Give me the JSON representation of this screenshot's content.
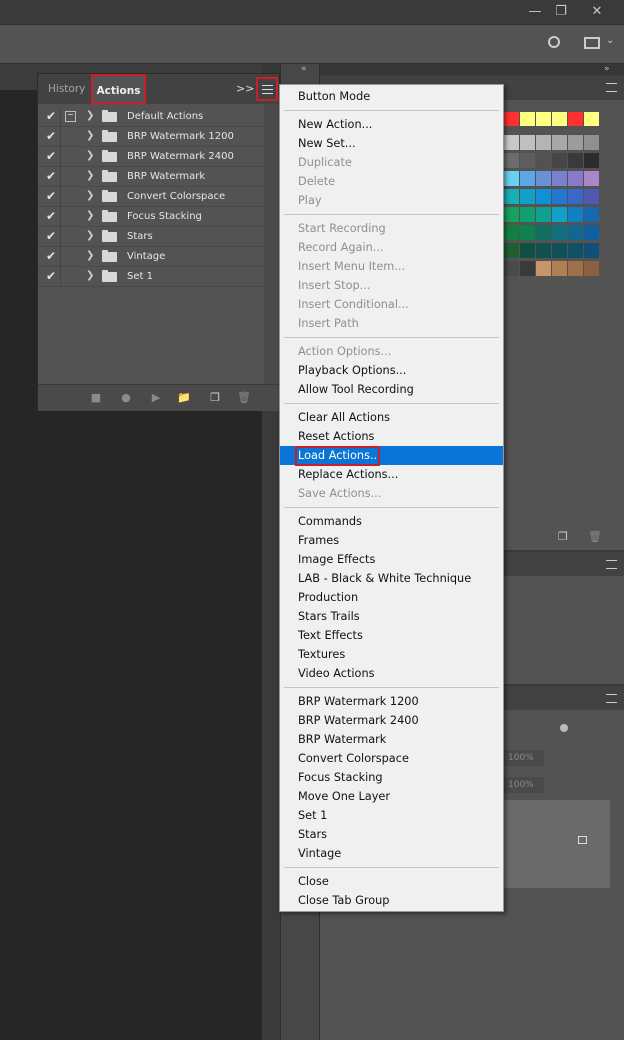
{
  "panel": {
    "tabs": [
      "History",
      "Actions"
    ],
    "actions": [
      {
        "label": "Default Actions",
        "checked": true,
        "dialog": true
      },
      {
        "label": "BRP Watermark 1200",
        "checked": true,
        "dialog": false
      },
      {
        "label": "BRP Watermark 2400",
        "checked": true,
        "dialog": false
      },
      {
        "label": "BRP Watermark",
        "checked": true,
        "dialog": false
      },
      {
        "label": "Convert Colorspace",
        "checked": true,
        "dialog": false
      },
      {
        "label": "Focus Stacking",
        "checked": true,
        "dialog": false
      },
      {
        "label": "Stars",
        "checked": true,
        "dialog": false
      },
      {
        "label": "Vintage",
        "checked": true,
        "dialog": false
      },
      {
        "label": "Set 1",
        "checked": true,
        "dialog": false
      }
    ]
  },
  "menu": {
    "groups": [
      [
        {
          "label": "Button Mode",
          "enabled": true
        }
      ],
      [
        {
          "label": "New Action...",
          "enabled": true
        },
        {
          "label": "New Set...",
          "enabled": true
        },
        {
          "label": "Duplicate",
          "enabled": false
        },
        {
          "label": "Delete",
          "enabled": false
        },
        {
          "label": "Play",
          "enabled": false
        }
      ],
      [
        {
          "label": "Start Recording",
          "enabled": false
        },
        {
          "label": "Record Again...",
          "enabled": false
        },
        {
          "label": "Insert Menu Item...",
          "enabled": false
        },
        {
          "label": "Insert Stop...",
          "enabled": false
        },
        {
          "label": "Insert Conditional...",
          "enabled": false
        },
        {
          "label": "Insert Path",
          "enabled": false
        }
      ],
      [
        {
          "label": "Action Options...",
          "enabled": false
        },
        {
          "label": "Playback Options...",
          "enabled": true
        },
        {
          "label": "Allow Tool Recording",
          "enabled": true
        }
      ],
      [
        {
          "label": "Clear All Actions",
          "enabled": true
        },
        {
          "label": "Reset Actions",
          "enabled": true
        },
        {
          "label": "Load Actions...",
          "enabled": true,
          "highlighted": true
        },
        {
          "label": "Replace Actions...",
          "enabled": true
        },
        {
          "label": "Save Actions...",
          "enabled": false
        }
      ],
      [
        {
          "label": "Commands",
          "enabled": true
        },
        {
          "label": "Frames",
          "enabled": true
        },
        {
          "label": "Image Effects",
          "enabled": true
        },
        {
          "label": "LAB - Black & White Technique",
          "enabled": true
        },
        {
          "label": "Production",
          "enabled": true
        },
        {
          "label": "Stars Trails",
          "enabled": true
        },
        {
          "label": "Text Effects",
          "enabled": true
        },
        {
          "label": "Textures",
          "enabled": true
        },
        {
          "label": "Video Actions",
          "enabled": true
        }
      ],
      [
        {
          "label": "BRP Watermark 1200",
          "enabled": true
        },
        {
          "label": "BRP Watermark 2400",
          "enabled": true
        },
        {
          "label": "BRP Watermark",
          "enabled": true
        },
        {
          "label": "Convert Colorspace",
          "enabled": true
        },
        {
          "label": "Focus Stacking",
          "enabled": true
        },
        {
          "label": "Move One Layer",
          "enabled": true
        },
        {
          "label": "Set 1",
          "enabled": true
        },
        {
          "label": "Stars",
          "enabled": true
        },
        {
          "label": "Vintage",
          "enabled": true
        }
      ],
      [
        {
          "label": "Close",
          "enabled": true
        },
        {
          "label": "Close Tab Group",
          "enabled": true
        }
      ]
    ]
  },
  "layers_opacity": [
    "100%",
    "100%"
  ],
  "colors": {
    "highlight": "#0a75d6",
    "annotation": "#c8202b",
    "swatch_rows": [
      [
        "#ff3030",
        "#ffff80",
        "#ffff80",
        "#ffff80",
        "#ff3030",
        "#ffff80"
      ],
      [
        "#c8c8c8",
        "#c0c0c0",
        "#b4b4b4",
        "#a8a8a8",
        "#9c9c9c",
        "#909090"
      ],
      [
        "#6c6c6c",
        "#5e5e5e",
        "#525252",
        "#464646",
        "#3a3a3a",
        "#2c2c2c"
      ],
      [
        "#6ad0f0",
        "#5aa8e8",
        "#6a90d8",
        "#7a80d0",
        "#8a78c8",
        "#a888c8"
      ],
      [
        "#18b0b8",
        "#10a0c8",
        "#1090d8",
        "#2078d0",
        "#3868c8",
        "#5058b0"
      ],
      [
        "#18a060",
        "#10a070",
        "#10a090",
        "#10a0c8",
        "#1080c0",
        "#1868b0"
      ],
      [
        "#108040",
        "#108050",
        "#107060",
        "#107080",
        "#106890",
        "#1060a0"
      ],
      [
        "#206030",
        "#105040",
        "#105050",
        "#105058",
        "#105068",
        "#105078"
      ],
      [
        "#4a4a4a",
        "#3a3a3a",
        "#c8946a",
        "#b08050",
        "#a07048",
        "#8a6040"
      ]
    ]
  }
}
